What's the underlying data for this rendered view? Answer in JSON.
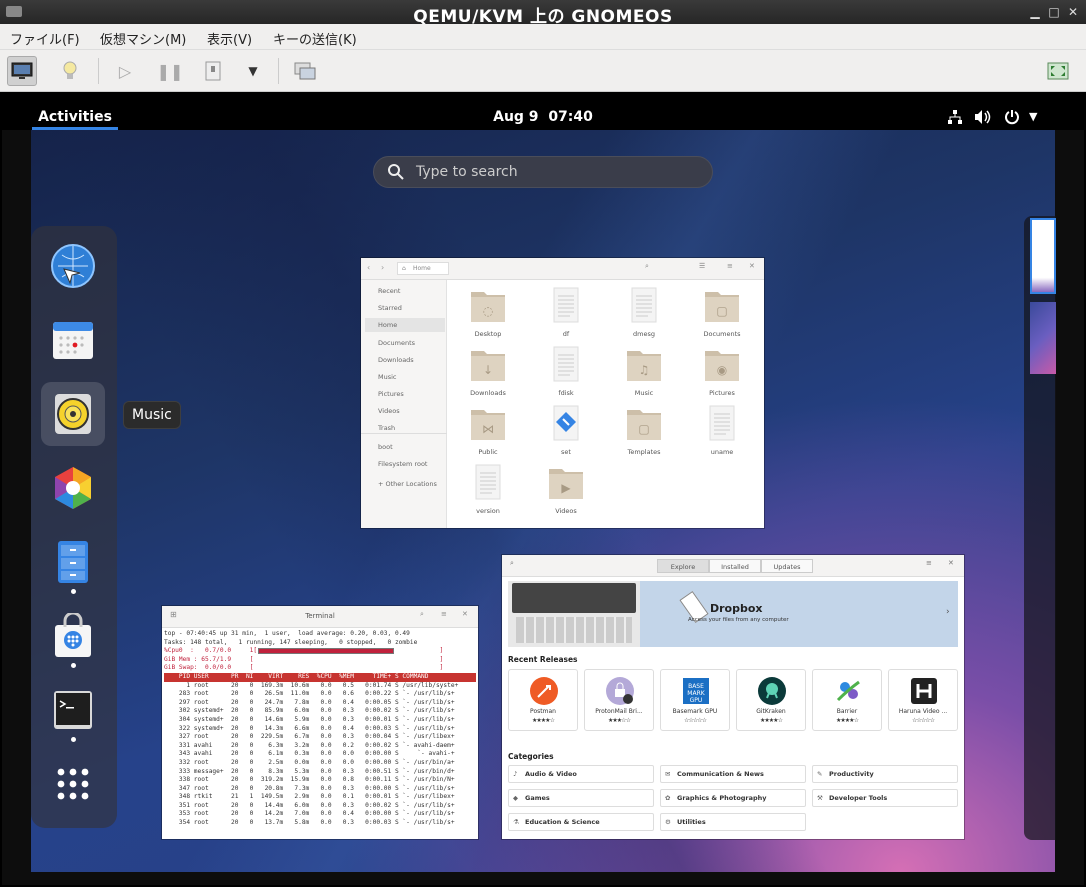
{
  "window": {
    "title": "QEMU/KVM 上の GNOMEOS"
  },
  "menu": [
    "ファイル(F)",
    "仮想マシン(M)",
    "表示(V)",
    "キーの送信(K)"
  ],
  "topbar": {
    "activities": "Activities",
    "date": "Aug 9",
    "time": "07:40"
  },
  "search": {
    "placeholder": "Type to search"
  },
  "tooltip": "Music",
  "files": {
    "location": "Home",
    "sidebar": [
      "Recent",
      "Starred",
      "Home",
      "Documents",
      "Downloads",
      "Music",
      "Pictures",
      "Videos",
      "Trash",
      "boot",
      "Filesystem root",
      "+ Other Locations"
    ],
    "items": [
      "Desktop",
      "df",
      "dmesg",
      "Documents",
      "Downloads",
      "fdisk",
      "Music",
      "Pictures",
      "Public",
      "set",
      "Templates",
      "uname",
      "version",
      "Videos"
    ]
  },
  "software": {
    "tabs": [
      "Explore",
      "Installed",
      "Updates"
    ],
    "banner_title": "Dropbox",
    "banner_sub": "Access your files from any computer",
    "recent_heading": "Recent Releases",
    "apps": [
      {
        "name": "Postman",
        "stars": "★★★★☆"
      },
      {
        "name": "ProtonMail Bri...",
        "stars": "★★★☆☆"
      },
      {
        "name": "Basemark GPU",
        "stars": "☆☆☆☆☆"
      },
      {
        "name": "GitKraken",
        "stars": "★★★★☆"
      },
      {
        "name": "Barrier",
        "stars": "★★★★☆"
      },
      {
        "name": "Haruna Video ...",
        "stars": "☆☆☆☆☆"
      }
    ],
    "categories_heading": "Categories",
    "categories": [
      "Audio & Video",
      "Communication & News",
      "Productivity",
      "Games",
      "Graphics & Photography",
      "Developer Tools",
      "Education & Science",
      "Utilities"
    ]
  },
  "terminal": {
    "title": "Terminal",
    "lines": [
      "top - 07:40:45 up 31 min,  1 user,  load average: 0.20, 0.03, 0.49",
      "Tasks: 148 total,   1 running, 147 sleeping,   0 stopped,   0 zombie",
      "%Cpu0  :   0.7/0.0     1[                                                 ]",
      "GiB Mem : 65.7/1.9     [                                                  ]",
      "GiB Swap:  0.0/0.0     [                                                  ]",
      "",
      "    PID USER      PR  NI    VIRT    RES  %CPU  %MEM     TIME+ S COMMAND",
      "      1 root      20   0  169.3m  10.6m   0.0   0.5   0:01.74 S /usr/lib/syste+",
      "    283 root      20   0   26.5m  11.0m   0.0   0.6   0:00.22 S `- /usr/lib/s+",
      "    297 root      20   0   24.7m   7.8m   0.0   0.4   0:00.05 S `- /usr/lib/s+",
      "    302 systemd+  20   0   85.9m   6.0m   0.0   0.3   0:00.02 S `- /usr/lib/s+",
      "    304 systemd+  20   0   14.6m   5.9m   0.0   0.3   0:00.01 S `- /usr/lib/s+",
      "    322 systemd+  20   0   14.3m   6.6m   0.0   0.4   0:00.03 S `- /usr/lib/s+",
      "    327 root      20   0  229.5m   6.7m   0.0   0.3   0:00.04 S `- /usr/libex+",
      "    331 avahi     20   0    6.3m   3.2m   0.0   0.2   0:00.02 S `- avahi-daem+",
      "    343 avahi     20   0    6.1m   0.3m   0.0   0.0   0:00.00 S     `- avahi-+",
      "    332 root      20   0    2.5m   0.0m   0.0   0.0   0:00.00 S `- /usr/bin/a+",
      "    333 message+  20   0    8.3m   5.3m   0.0   0.3   0:00.51 S `- /usr/bin/d+",
      "    338 root      20   0  319.2m  15.9m   0.0   0.8   0:00.11 S `- /usr/bin/N+",
      "    347 root      20   0   20.8m   7.3m   0.0   0.3   0:00.00 S `- /usr/lib/s+",
      "    348 rtkit     21   1  149.5m   2.9m   0.0   0.1   0:00.01 S `- /usr/libex+",
      "    351 root      20   0   14.4m   6.0m   0.0   0.3   0:00.02 S `- /usr/lib/s+",
      "    353 root      20   0   14.2m   7.0m   0.0   0.4   0:00.00 S `- /usr/lib/s+",
      "    354 root      20   0   13.7m   5.8m   0.0   0.3   0:00.03 S `- /usr/lib/s+"
    ]
  }
}
